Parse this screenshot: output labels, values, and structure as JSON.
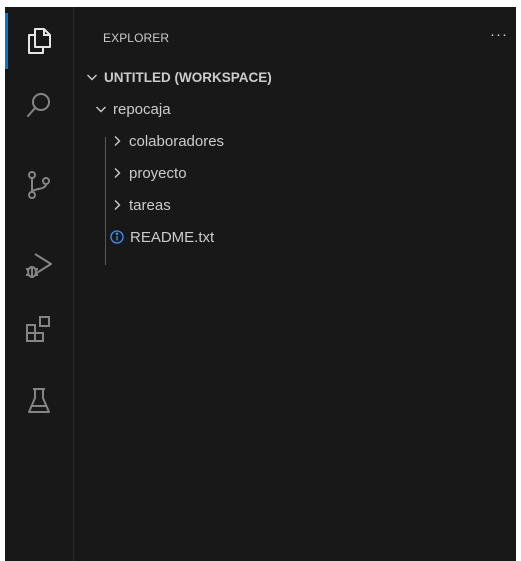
{
  "activity_bar": {
    "items": [
      {
        "name": "explorer",
        "icon": "files-icon",
        "active": true
      },
      {
        "name": "search",
        "icon": "search-icon",
        "active": false
      },
      {
        "name": "source-control",
        "icon": "source-control-icon",
        "active": false
      },
      {
        "name": "run-and-debug",
        "icon": "run-debug-icon",
        "active": false
      },
      {
        "name": "extensions",
        "icon": "extensions-icon",
        "active": false
      },
      {
        "name": "testing",
        "icon": "beaker-icon",
        "active": false
      }
    ]
  },
  "sidebar": {
    "title": "EXPLORER",
    "more_actions": "···",
    "workspace": {
      "label": "UNTITLED (WORKSPACE)",
      "expanded": true,
      "root": {
        "label": "repocaja",
        "expanded": true,
        "children": [
          {
            "label": "colaboradores",
            "type": "folder",
            "expanded": false
          },
          {
            "label": "proyecto",
            "type": "folder",
            "expanded": false
          },
          {
            "label": "tareas",
            "type": "folder",
            "expanded": false
          },
          {
            "label": "README.txt",
            "type": "file",
            "icon": "info-icon"
          }
        ]
      }
    }
  },
  "colors": {
    "background": "#181818",
    "foreground": "#cccccc",
    "active_indicator": "#0078d4",
    "info_icon": "#3794ff"
  }
}
